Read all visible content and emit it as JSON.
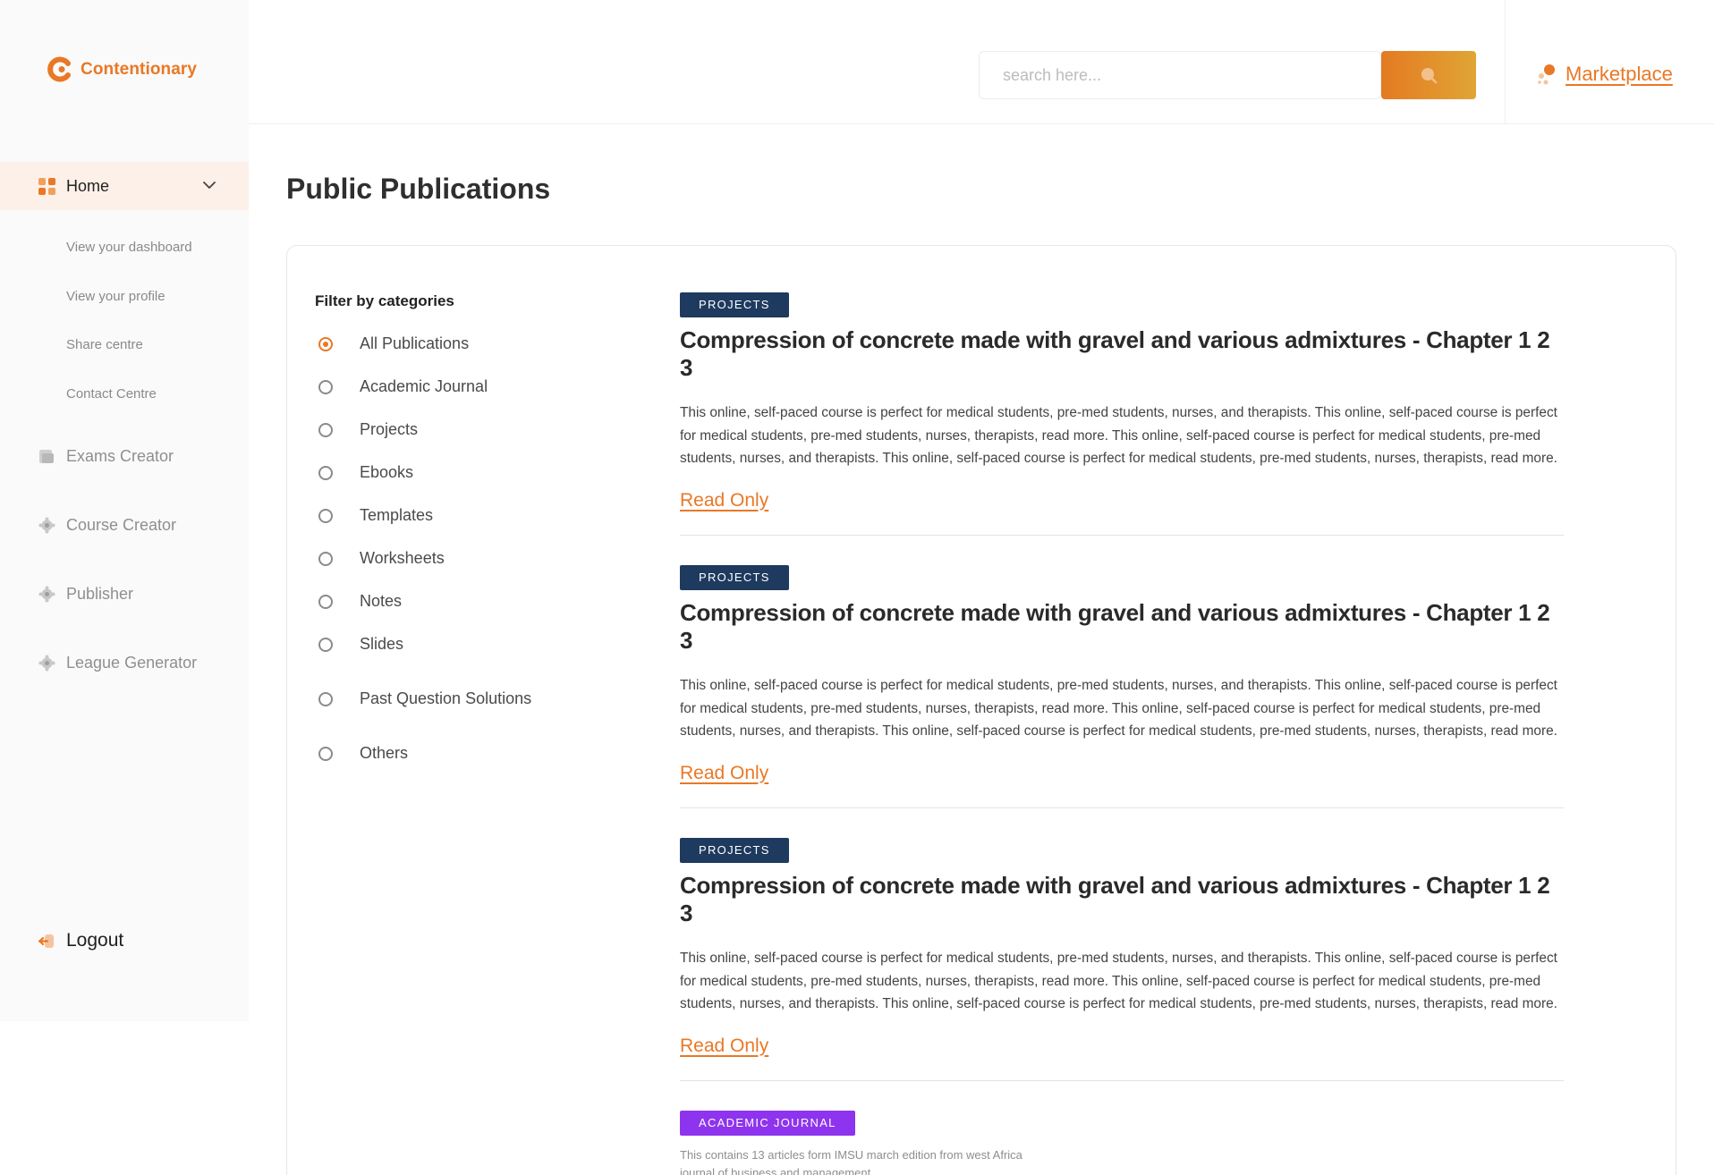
{
  "app": {
    "name": "Contentionary",
    "brand_color": "#e97825"
  },
  "sidebar": {
    "home_label": "Home",
    "sub_items": [
      "View your dashboard",
      "View your profile",
      "Share centre",
      "Contact Centre"
    ],
    "items": [
      "Exams Creator",
      "Course Creator",
      "Publisher",
      "League Generator"
    ],
    "logout_label": "Logout"
  },
  "header": {
    "search_placeholder": "search here...",
    "marketplace_label": "Marketplace"
  },
  "page": {
    "title": "Public Publications"
  },
  "filters": {
    "title": "Filter by categories",
    "selected": "All Publications",
    "options": [
      "All Publications",
      "Academic Journal",
      "Projects",
      "Ebooks",
      "Templates",
      "Worksheets",
      "Notes",
      "Slides",
      "Past Question Solutions",
      "Others"
    ]
  },
  "publications": [
    {
      "tag": "PROJECTS",
      "title": "Compression of concrete made with gravel and various admixtures - Chapter 1 2 3",
      "description": "This online, self-paced course is perfect for medical students, pre-med students, nurses, and therapists. This online, self-paced course is perfect for medical students, pre-med students, nurses, therapists, read more. This online, self-paced course is perfect for medical students, pre-med students, nurses, and therapists. This online, self-paced course is perfect for medical students, pre-med students, nurses, therapists, read more.",
      "link": "Read Only"
    },
    {
      "tag": "PROJECTS",
      "title": "Compression of concrete made with gravel and various admixtures - Chapter 1 2 3",
      "description": "This online, self-paced course is perfect for medical students, pre-med students, nurses, and therapists. This online, self-paced course is perfect for medical students, pre-med students, nurses, therapists, read more. This online, self-paced course is perfect for medical students, pre-med students, nurses, and therapists. This online, self-paced course is perfect for medical students, pre-med students, nurses, therapists, read more.",
      "link": "Read Only"
    },
    {
      "tag": "PROJECTS",
      "title": "Compression of concrete made with gravel and various admixtures - Chapter 1 2 3",
      "description": "This online, self-paced course is perfect for medical students, pre-med students, nurses, and therapists. This online, self-paced course is perfect for medical students, pre-med students, nurses, therapists, read more. This online, self-paced course is perfect for medical students, pre-med students, nurses, and therapists. This online, self-paced course is perfect for medical students, pre-med students, nurses, therapists, read more.",
      "link": "Read Only"
    },
    {
      "tag": "ACADEMIC JOURNAL",
      "description": "This contains 13 articles form IMSU march edition from west Africa journal of business and management"
    }
  ]
}
